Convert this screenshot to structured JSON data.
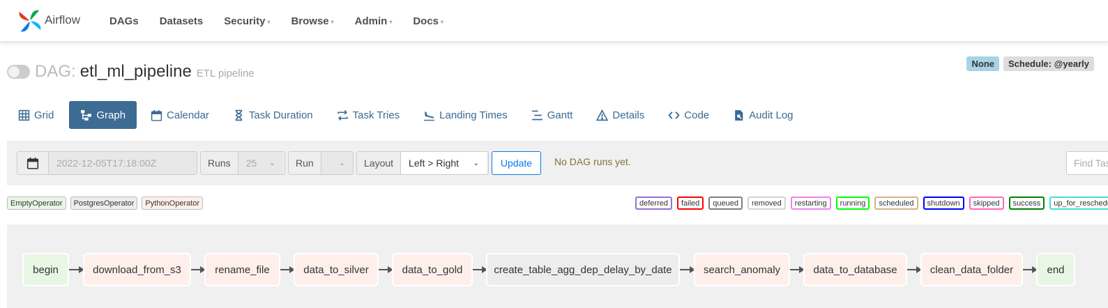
{
  "navbar": {
    "brand": "Airflow",
    "items": [
      {
        "label": "DAGs",
        "dropdown": false
      },
      {
        "label": "Datasets",
        "dropdown": false
      },
      {
        "label": "Security",
        "dropdown": true
      },
      {
        "label": "Browse",
        "dropdown": true
      },
      {
        "label": "Admin",
        "dropdown": true
      },
      {
        "label": "Docs",
        "dropdown": true
      }
    ]
  },
  "dag": {
    "prefix": "DAG:",
    "id": "etl_ml_pipeline",
    "description": "ETL pipeline",
    "badge_none": "None",
    "badge_schedule": "Schedule: @yearly"
  },
  "tabs": [
    {
      "label": "Grid",
      "icon": "grid-icon",
      "active": false
    },
    {
      "label": "Graph",
      "icon": "graph-icon",
      "active": true
    },
    {
      "label": "Calendar",
      "icon": "calendar-icon",
      "active": false
    },
    {
      "label": "Task Duration",
      "icon": "hourglass-icon",
      "active": false
    },
    {
      "label": "Task Tries",
      "icon": "retry-icon",
      "active": false
    },
    {
      "label": "Landing Times",
      "icon": "landing-icon",
      "active": false
    },
    {
      "label": "Gantt",
      "icon": "gantt-icon",
      "active": false
    },
    {
      "label": "Details",
      "icon": "warning-triangle-icon",
      "active": false
    },
    {
      "label": "Code",
      "icon": "code-icon",
      "active": false
    },
    {
      "label": "Audit Log",
      "icon": "audit-log-icon",
      "active": false
    }
  ],
  "controls": {
    "date_value": "2022-12-05T17:18:00Z",
    "runs_label": "Runs",
    "runs_value": "25",
    "run_label": "Run",
    "run_value": "",
    "layout_label": "Layout",
    "layout_value": "Left > Right",
    "update_label": "Update",
    "no_runs_text": "No DAG runs yet.",
    "find_placeholder": "Find Task..."
  },
  "operators": [
    {
      "label": "EmptyOperator",
      "color": "#e8f7e4"
    },
    {
      "label": "PostgresOperator",
      "color": "#ededed"
    },
    {
      "label": "PythonOperator",
      "color": "#ffefeb"
    }
  ],
  "states": [
    {
      "label": "deferred",
      "color": "#9370db"
    },
    {
      "label": "failed",
      "color": "#ff0000"
    },
    {
      "label": "queued",
      "color": "#808080"
    },
    {
      "label": "removed",
      "color": "#d3d3d3"
    },
    {
      "label": "restarting",
      "color": "#ee82ee"
    },
    {
      "label": "running",
      "color": "#00ff00"
    },
    {
      "label": "scheduled",
      "color": "#d2b48c"
    },
    {
      "label": "shutdown",
      "color": "#0000ff"
    },
    {
      "label": "skipped",
      "color": "#ff69b4"
    },
    {
      "label": "success",
      "color": "#008000"
    },
    {
      "label": "up_for_reschedule",
      "color": "#40e0d0"
    }
  ],
  "graph": {
    "nodes": [
      {
        "label": "begin",
        "operator": "EmptyOperator"
      },
      {
        "label": "download_from_s3",
        "operator": "PythonOperator"
      },
      {
        "label": "rename_file",
        "operator": "PythonOperator"
      },
      {
        "label": "data_to_silver",
        "operator": "PythonOperator"
      },
      {
        "label": "data_to_gold",
        "operator": "PythonOperator"
      },
      {
        "label": "create_table_agg_dep_delay_by_date",
        "operator": "PostgresOperator"
      },
      {
        "label": "search_anomaly",
        "operator": "PythonOperator"
      },
      {
        "label": "data_to_database",
        "operator": "PythonOperator"
      },
      {
        "label": "clean_data_folder",
        "operator": "PythonOperator"
      },
      {
        "label": "end",
        "operator": "EmptyOperator"
      }
    ]
  }
}
